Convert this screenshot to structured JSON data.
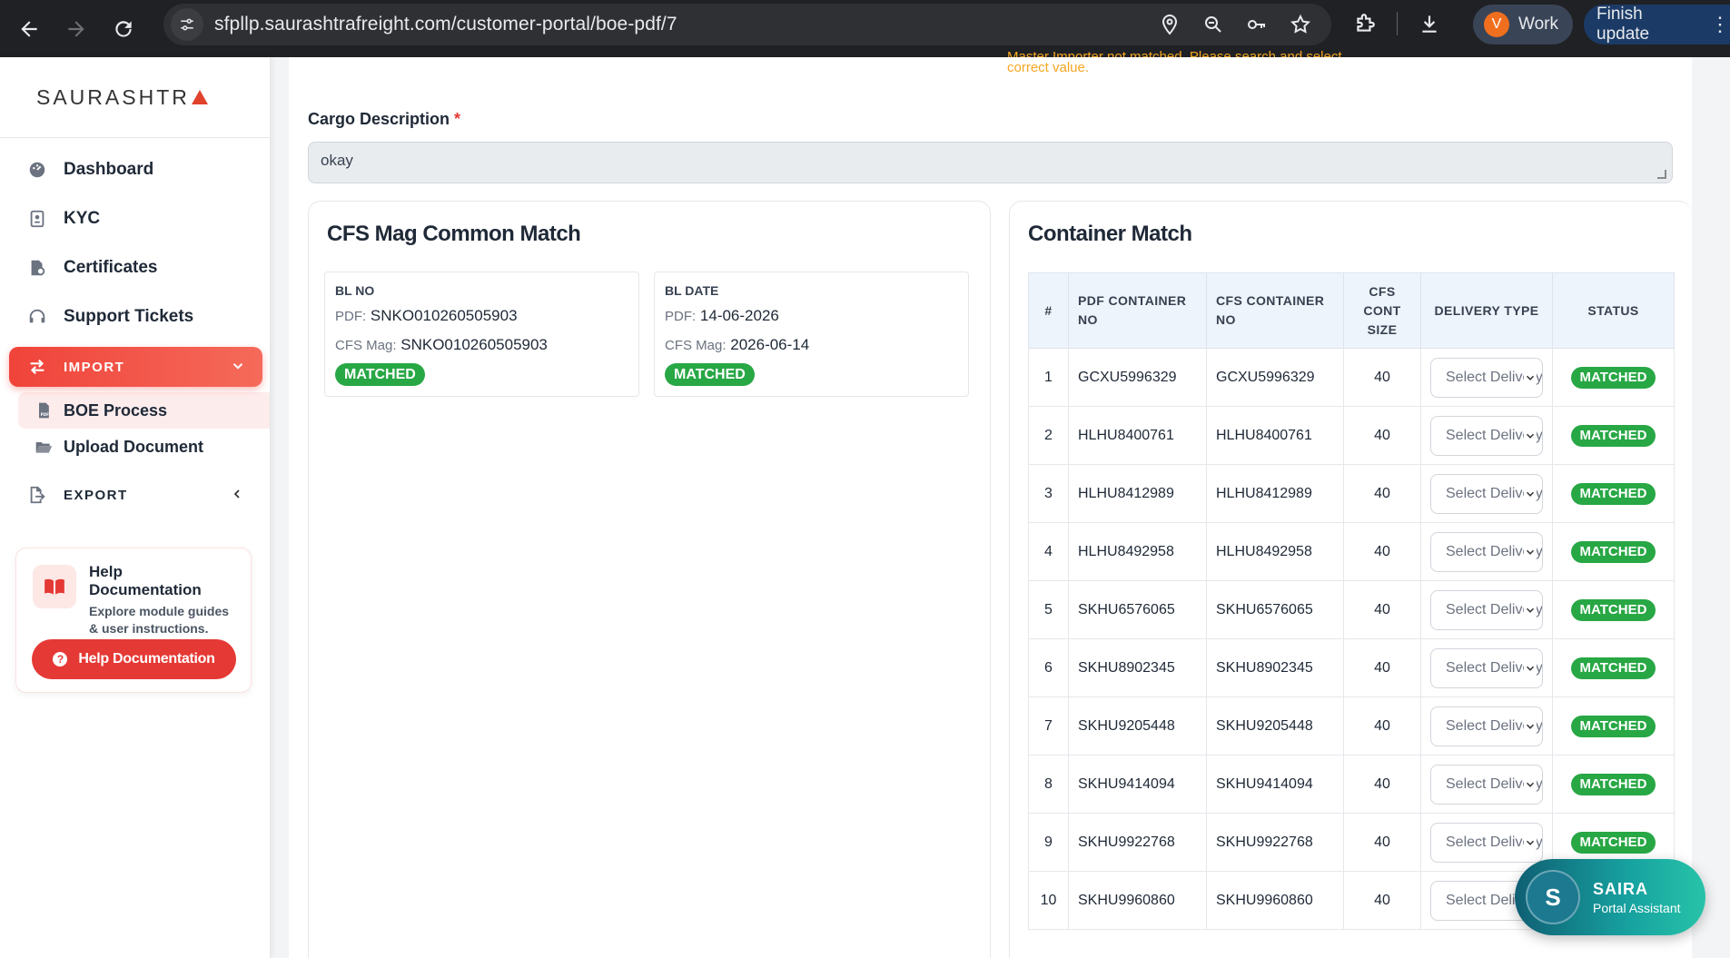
{
  "browser": {
    "url": "sfpllp.saurashtrafreight.com/customer-portal/boe-pdf/7",
    "profile_initial": "V",
    "profile_label": "Work",
    "update_label": "Finish update",
    "update_more": "⋮"
  },
  "sidebar": {
    "logo": "SAURASHTR",
    "items": [
      {
        "label": "Dashboard",
        "icon": "dashboard-icon"
      },
      {
        "label": "KYC",
        "icon": "id-card-icon"
      },
      {
        "label": "Certificates",
        "icon": "certificate-icon"
      },
      {
        "label": "Support Tickets",
        "icon": "headset-icon"
      }
    ],
    "import_label": "IMPORT",
    "import_sub": [
      {
        "label": "BOE Process",
        "icon": "pdf-file-icon",
        "active": true
      },
      {
        "label": "Upload Document",
        "icon": "folder-open-icon",
        "active": false
      }
    ],
    "export_label": "EXPORT"
  },
  "help": {
    "title": "Help Documentation",
    "desc": "Explore module guides & user instructions.",
    "button": "Help Documentation",
    "button_icon": "?"
  },
  "main": {
    "warning_line1": "Master Importer not matched. Please search and select",
    "warning_line2": "correct value.",
    "cargo_label": "Cargo Description",
    "required_mark": "*",
    "cargo_value": "okay"
  },
  "cfs_match": {
    "title": "CFS Mag Common Match",
    "bl_no": {
      "label": "BL NO",
      "pdf_key": "PDF:",
      "pdf_value": "SNKO010260505903",
      "cfs_key": "CFS Mag:",
      "cfs_value": "SNKO010260505903",
      "status": "MATCHED"
    },
    "bl_date": {
      "label": "BL DATE",
      "pdf_key": "PDF:",
      "pdf_value": "14-06-2026",
      "cfs_key": "CFS Mag:",
      "cfs_value": "2026-06-14",
      "status": "MATCHED"
    }
  },
  "container_match": {
    "title": "Container Match",
    "headers": [
      "#",
      "PDF CONTAINER NO",
      "CFS CONTAINER NO",
      "CFS CONT SIZE",
      "DELIVERY TYPE",
      "STATUS"
    ],
    "select_placeholder": "Select Delivery Type",
    "rows": [
      {
        "n": "1",
        "pdf": "GCXU5996329",
        "cfs": "GCXU5996329",
        "size": "40",
        "status": "MATCHED"
      },
      {
        "n": "2",
        "pdf": "HLHU8400761",
        "cfs": "HLHU8400761",
        "size": "40",
        "status": "MATCHED"
      },
      {
        "n": "3",
        "pdf": "HLHU8412989",
        "cfs": "HLHU8412989",
        "size": "40",
        "status": "MATCHED"
      },
      {
        "n": "4",
        "pdf": "HLHU8492958",
        "cfs": "HLHU8492958",
        "size": "40",
        "status": "MATCHED"
      },
      {
        "n": "5",
        "pdf": "SKHU6576065",
        "cfs": "SKHU6576065",
        "size": "40",
        "status": "MATCHED"
      },
      {
        "n": "6",
        "pdf": "SKHU8902345",
        "cfs": "SKHU8902345",
        "size": "40",
        "status": "MATCHED"
      },
      {
        "n": "7",
        "pdf": "SKHU9205448",
        "cfs": "SKHU9205448",
        "size": "40",
        "status": "MATCHED"
      },
      {
        "n": "8",
        "pdf": "SKHU9414094",
        "cfs": "SKHU9414094",
        "size": "40",
        "status": "MATCHED"
      },
      {
        "n": "9",
        "pdf": "SKHU9922768",
        "cfs": "SKHU9922768",
        "size": "40",
        "status": "MATCHED"
      },
      {
        "n": "10",
        "pdf": "SKHU9960860",
        "cfs": "SKHU9960860",
        "size": "40",
        "status": ""
      }
    ]
  },
  "assistant": {
    "initial": "S",
    "name": "SAIRA",
    "subtitle": "Portal Assistant"
  },
  "colors": {
    "accent": "#f0433a",
    "matched": "#28a745",
    "warning": "#f5a623"
  }
}
